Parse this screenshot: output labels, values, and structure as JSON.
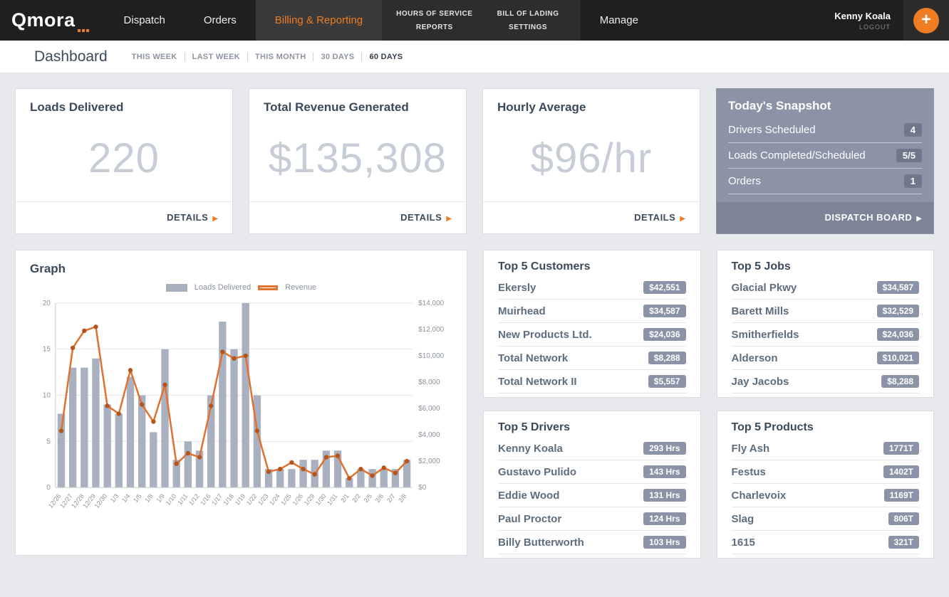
{
  "brand": {
    "logo": "Qmora"
  },
  "nav": {
    "items": [
      {
        "label": "Dispatch"
      },
      {
        "label": "Orders"
      },
      {
        "label": "Billing & Reporting",
        "active": true
      },
      {
        "label": "Manage"
      }
    ],
    "submenu": [
      "HOURS OF SERVICE",
      "BILL OF LADING",
      "REPORTS",
      "SETTINGS"
    ],
    "user": {
      "name": "Kenny Koala",
      "logout": "LOGOUT"
    },
    "add_label": "+"
  },
  "header": {
    "title": "Dashboard",
    "filters": [
      "THIS WEEK",
      "LAST WEEK",
      "THIS MONTH",
      "30 DAYS",
      "60 DAYS"
    ],
    "active_filter": "60 DAYS"
  },
  "cards": {
    "loads": {
      "title": "Loads Delivered",
      "value": "220",
      "details": "DETAILS"
    },
    "revenue": {
      "title": "Total Revenue Generated",
      "value": "$135,308",
      "details": "DETAILS"
    },
    "hourly": {
      "title": "Hourly Average",
      "value": "$96/hr",
      "details": "DETAILS"
    }
  },
  "snapshot": {
    "title": "Today's Snapshot",
    "rows": [
      {
        "label": "Drivers Scheduled",
        "value": "4"
      },
      {
        "label": "Loads Completed/Scheduled",
        "value": "5/5"
      },
      {
        "label": "Orders",
        "value": "1"
      }
    ],
    "footer": "DISPATCH BOARD"
  },
  "graph": {
    "title": "Graph"
  },
  "chart_data": {
    "type": "bar+line",
    "x": [
      "12/26",
      "12/27",
      "12/28",
      "12/29",
      "12/30",
      "1/3",
      "1/4",
      "1/5",
      "1/8",
      "1/9",
      "1/10",
      "1/11",
      "1/12",
      "1/16",
      "1/17",
      "1/18",
      "1/19",
      "1/22",
      "1/23",
      "1/24",
      "1/25",
      "1/26",
      "1/29",
      "1/30",
      "1/31",
      "2/1",
      "2/2",
      "2/5",
      "2/6",
      "2/7",
      "2/8"
    ],
    "series": [
      {
        "name": "Loads Delivered",
        "type": "bar",
        "axis": "left",
        "values": [
          8,
          13,
          13,
          14,
          9,
          8,
          12,
          10,
          6,
          15,
          3,
          5,
          4,
          10,
          18,
          15,
          20,
          10,
          2,
          2,
          2,
          3,
          3,
          4,
          4,
          1,
          2,
          2,
          2,
          2,
          3
        ]
      },
      {
        "name": "Revenue",
        "type": "line",
        "axis": "right",
        "values": [
          4300,
          10600,
          11900,
          12200,
          6200,
          5600,
          8900,
          6300,
          5000,
          7800,
          1800,
          2600,
          2300,
          6200,
          10300,
          9800,
          10000,
          4300,
          1200,
          1400,
          1900,
          1400,
          1000,
          2300,
          2400,
          700,
          1400,
          900,
          1500,
          1100,
          2000
        ]
      }
    ],
    "left_axis": {
      "ticks": [
        0,
        5,
        10,
        15,
        20
      ],
      "max": 20
    },
    "right_axis": {
      "tick_labels": [
        "$0",
        "$2,000",
        "$4,000",
        "$6,000",
        "$8,000",
        "$10,000",
        "$12,000",
        "$14,000"
      ],
      "step": 2000,
      "max": 14000
    },
    "bar_color": "#a9b1c0",
    "line_color": "#e0722f",
    "point_color": "#b5541c",
    "legend_position": "top",
    "grid": true
  },
  "top_customers": {
    "title": "Top 5 Customers",
    "items": [
      {
        "name": "Ekersly",
        "value": "$42,551"
      },
      {
        "name": "Muirhead",
        "value": "$34,587"
      },
      {
        "name": "New Products Ltd.",
        "value": "$24,036"
      },
      {
        "name": "Total Network",
        "value": "$8,288"
      },
      {
        "name": "Total Network II",
        "value": "$5,557"
      }
    ]
  },
  "top_jobs": {
    "title": "Top 5 Jobs",
    "items": [
      {
        "name": "Glacial Pkwy",
        "value": "$34,587"
      },
      {
        "name": "Barett Mills",
        "value": "$32,529"
      },
      {
        "name": "Smitherfields",
        "value": "$24,036"
      },
      {
        "name": "Alderson",
        "value": "$10,021"
      },
      {
        "name": "Jay Jacobs",
        "value": "$8,288"
      }
    ]
  },
  "top_drivers": {
    "title": "Top 5 Drivers",
    "items": [
      {
        "name": "Kenny Koala",
        "value": "293 Hrs"
      },
      {
        "name": "Gustavo Pulido",
        "value": "143 Hrs"
      },
      {
        "name": "Eddie Wood",
        "value": "131 Hrs"
      },
      {
        "name": "Paul Proctor",
        "value": "124 Hrs"
      },
      {
        "name": "Billy Butterworth",
        "value": "103 Hrs"
      }
    ]
  },
  "top_products": {
    "title": "Top 5 Products",
    "items": [
      {
        "name": "Fly Ash",
        "value": "1771T"
      },
      {
        "name": "Festus",
        "value": "1402T"
      },
      {
        "name": "Charlevoix",
        "value": "1169T"
      },
      {
        "name": "Slag",
        "value": "806T"
      },
      {
        "name": "1615",
        "value": "321T"
      }
    ]
  },
  "colors": {
    "accent": "#ef7d23",
    "nav_bg": "#1f1f1f",
    "snapshot_bg": "#8b93a7",
    "badge_bg": "#8b93a7",
    "page_bg": "#e7e9ec"
  }
}
